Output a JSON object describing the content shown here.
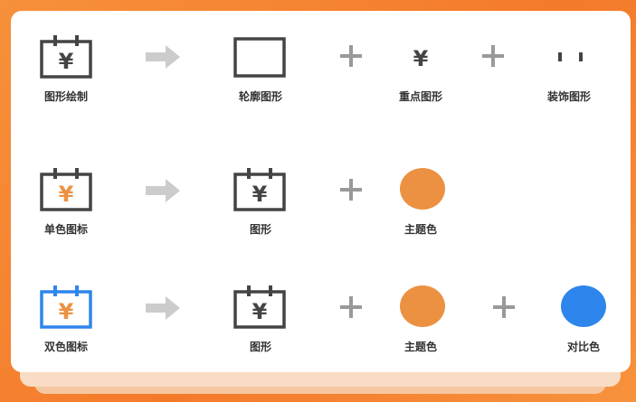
{
  "colors": {
    "dark": "#444444",
    "theme": "#ec9142",
    "contrast": "#2e86ec",
    "arrow": "#cccccc",
    "plus": "#999999"
  },
  "row1": {
    "labels": [
      "图形绘制",
      "轮廓图形",
      "重点图形",
      "装饰图形"
    ],
    "yuan": "¥"
  },
  "row2": {
    "labels": [
      "单色图标",
      "图形",
      "主题色"
    ],
    "yuan": "¥"
  },
  "row3": {
    "labels": [
      "双色图标",
      "图形",
      "主题色",
      "对比色"
    ],
    "yuan": "¥"
  }
}
